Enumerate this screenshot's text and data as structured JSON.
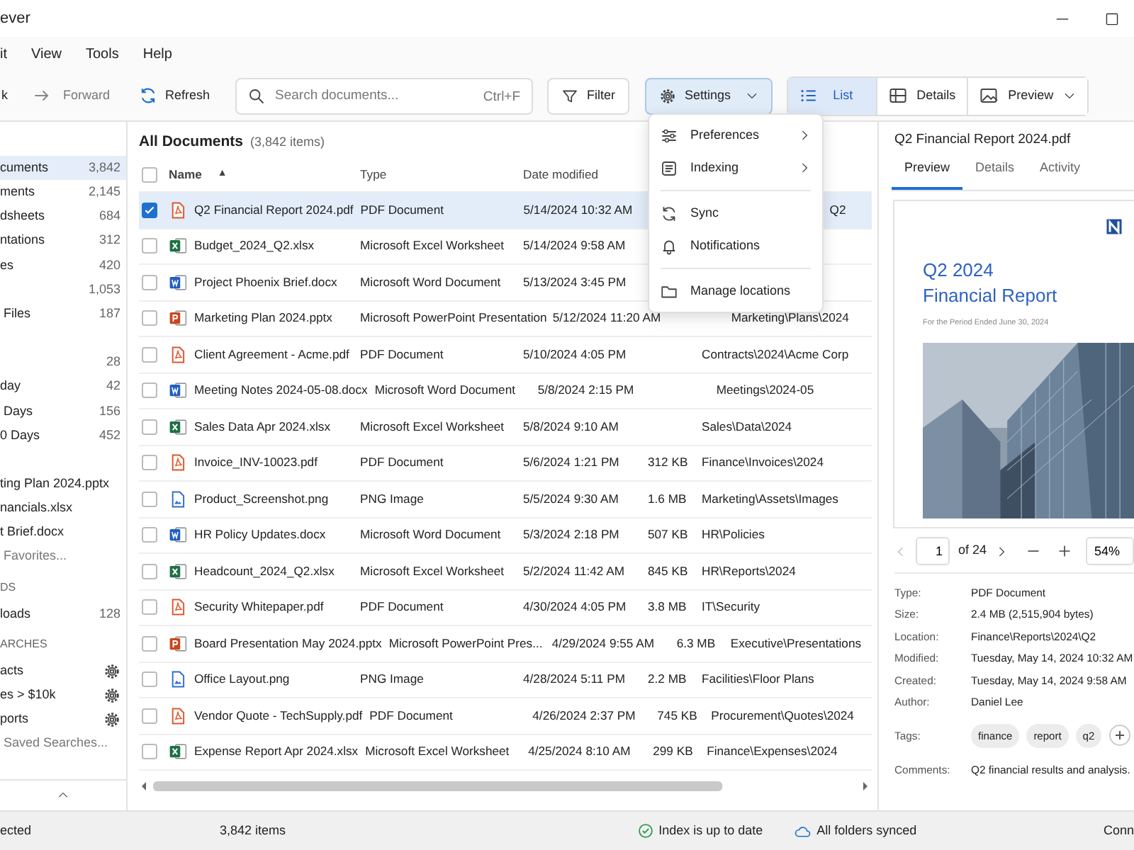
{
  "window": {
    "title": "ever"
  },
  "menu_bar": [
    "it",
    "View",
    "Tools",
    "Help"
  ],
  "toolbar": {
    "back": "k",
    "forward": {
      "label": "Forward",
      "disabled": true
    },
    "refresh": "Refresh",
    "search": {
      "placeholder": "Search documents...",
      "shortcut": "Ctrl+F"
    },
    "filter": "Filter",
    "settings": {
      "label": "Settings",
      "expanded": true
    },
    "views": [
      {
        "label": "List",
        "kind": "list",
        "selected": true,
        "dropdown": false
      },
      {
        "label": "Details",
        "kind": "details",
        "selected": false,
        "dropdown": false
      },
      {
        "label": "Preview",
        "kind": "preview",
        "selected": false,
        "dropdown": true
      }
    ]
  },
  "settings_menu": [
    [
      {
        "label": "Preferences",
        "kind": "preferences",
        "submenu": true
      },
      {
        "label": "Indexing",
        "kind": "indexing",
        "submenu": true
      }
    ],
    [
      {
        "label": "Sync",
        "kind": "sync",
        "submenu": false
      },
      {
        "label": "Notifications",
        "kind": "notifications",
        "submenu": false
      }
    ],
    [
      {
        "label": "Manage locations",
        "kind": "folder",
        "submenu": false
      }
    ]
  ],
  "sidebar": {
    "groups": [
      {
        "items": [
          {
            "label": "cuments",
            "count": "3,842",
            "selected": true
          },
          {
            "label": "ments",
            "count": "2,145",
            "selected": false
          },
          {
            "label": "dsheets",
            "count": "684",
            "selected": false
          },
          {
            "label": "ntations",
            "count": "312",
            "selected": false
          },
          {
            "label": "es",
            "count": "420",
            "selected": false
          },
          {
            "count": "1,053",
            "selected": false
          },
          {
            "label": " Files",
            "count": "187",
            "selected": false
          }
        ]
      },
      {
        "items": [
          {
            "count": "28",
            "selected": false
          },
          {
            "label": "day",
            "count": "42",
            "selected": false
          },
          {
            "label": " Days",
            "count": "156",
            "selected": false
          },
          {
            "label": "0 Days",
            "count": "452",
            "selected": false
          }
        ]
      },
      {
        "items": [
          {
            "label": "ting Plan 2024.pptx",
            "selected": false
          },
          {
            "label": "nancials.xlsx",
            "selected": false
          },
          {
            "label": "t Brief.docx",
            "selected": false
          },
          {
            "label": " Favorites...",
            "kind": "link",
            "selected": false
          }
        ]
      },
      {
        "heading": "DS",
        "items": [
          {
            "label": "loads",
            "count": "128",
            "selected": false
          }
        ]
      },
      {
        "heading": "ARCHES",
        "items": [
          {
            "label": "acts",
            "kind": "search",
            "selected": false
          },
          {
            "label": "es > $10k",
            "kind": "search",
            "selected": false
          },
          {
            "label": "ports",
            "kind": "search",
            "selected": false
          },
          {
            "label": " Saved Searches...",
            "kind": "link",
            "selected": false
          }
        ]
      }
    ]
  },
  "content": {
    "title": "All Documents",
    "count": "(3,842 items)",
    "select_all": false,
    "columns": [
      {
        "label": "Name",
        "sort_indicator": "▲"
      },
      {
        "label": "Type"
      },
      {
        "label": "Date modified"
      }
    ],
    "rows": [
      {
        "kind": "pdf",
        "name": "Q2 Financial Report 2024.pdf",
        "type": "PDF Document",
        "modified": "5/14/2024 10:32 AM",
        "location": "Q2",
        "checked": true,
        "selected": true
      },
      {
        "kind": "xlsx",
        "name": "Budget_2024_Q2.xlsx",
        "type": "Microsoft Excel Worksheet",
        "modified": "5/14/2024 9:58 AM",
        "checked": false,
        "selected": false
      },
      {
        "kind": "docx",
        "name": "Project Phoenix Brief.docx",
        "type": "Microsoft Word Document",
        "modified": "5/13/2024 3:45 PM",
        "checked": false,
        "selected": false
      },
      {
        "kind": "pptx",
        "name": "Marketing Plan 2024.pptx",
        "type": "Microsoft PowerPoint Presentation",
        "modified": "5/12/2024 11:20 AM",
        "location": "Marketing\\Plans\\2024",
        "checked": false,
        "selected": false
      },
      {
        "kind": "pdf",
        "name": "Client Agreement - Acme.pdf",
        "type": "PDF Document",
        "modified": "5/10/2024 4:05 PM",
        "location": "Contracts\\2024\\Acme Corp",
        "checked": false,
        "selected": false
      },
      {
        "kind": "docx",
        "name": "Meeting Notes 2024-05-08.docx",
        "type": "Microsoft Word Document",
        "modified": "5/8/2024 2:15 PM",
        "location": "Meetings\\2024-05",
        "checked": false,
        "selected": false
      },
      {
        "kind": "xlsx",
        "name": "Sales Data Apr 2024.xlsx",
        "type": "Microsoft Excel Worksheet",
        "modified": "5/8/2024 9:10 AM",
        "location": "Sales\\Data\\2024",
        "checked": false,
        "selected": false
      },
      {
        "kind": "pdf",
        "name": "Invoice_INV-10023.pdf",
        "type": "PDF Document",
        "modified": "5/6/2024 1:21 PM",
        "size": "312 KB",
        "location": "Finance\\Invoices\\2024",
        "checked": false,
        "selected": false
      },
      {
        "kind": "png",
        "name": "Product_Screenshot.png",
        "type": "PNG Image",
        "modified": "5/5/2024 9:30 AM",
        "size": "1.6 MB",
        "location": "Marketing\\Assets\\Images",
        "checked": false,
        "selected": false
      },
      {
        "kind": "docx",
        "name": "HR Policy Updates.docx",
        "type": "Microsoft Word Document",
        "modified": "5/3/2024 2:18 PM",
        "size": "507 KB",
        "location": "HR\\Policies",
        "checked": false,
        "selected": false
      },
      {
        "kind": "xlsx",
        "name": "Headcount_2024_Q2.xlsx",
        "type": "Microsoft Excel Worksheet",
        "modified": "5/2/2024 11:42 AM",
        "size": "845 KB",
        "location": "HR\\Reports\\2024",
        "checked": false,
        "selected": false
      },
      {
        "kind": "pdf",
        "name": "Security Whitepaper.pdf",
        "type": "PDF Document",
        "modified": "4/30/2024 4:05 PM",
        "size": "3.8 MB",
        "location": "IT\\Security",
        "checked": false,
        "selected": false
      },
      {
        "kind": "pptx",
        "name": "Board Presentation May 2024.pptx",
        "type": "Microsoft PowerPoint Pres...",
        "modified": "4/29/2024 9:55 AM",
        "size": "6.3 MB",
        "location": "Executive\\Presentations",
        "checked": false,
        "selected": false
      },
      {
        "kind": "png",
        "name": "Office Layout.png",
        "type": "PNG Image",
        "modified": "4/28/2024 5:11 PM",
        "size": "2.2 MB",
        "location": "Facilities\\Floor Plans",
        "checked": false,
        "selected": false
      },
      {
        "kind": "pdf",
        "name": "Vendor Quote - TechSupply.pdf",
        "type": "PDF Document",
        "modified": "4/26/2024 2:37 PM",
        "size": "745 KB",
        "location": "Procurement\\Quotes\\2024",
        "checked": false,
        "selected": false
      },
      {
        "kind": "xlsx",
        "name": "Expense Report Apr 2024.xlsx",
        "type": "Microsoft Excel Worksheet",
        "modified": "4/25/2024 8:10 AM",
        "size": "299 KB",
        "location": "Finance\\Expenses\\2024",
        "checked": false,
        "selected": false
      }
    ]
  },
  "preview": {
    "title": "Q2 Financial Report 2024.pdf",
    "tabs": [
      {
        "label": "Preview",
        "selected": true
      },
      {
        "label": "Details",
        "selected": false
      },
      {
        "label": "Activity",
        "selected": false
      }
    ],
    "document": {
      "heading": [
        "Q2 2024",
        "Financial Report"
      ],
      "subtitle": "For the Period Ended June 30, 2024",
      "kind": "picture"
    },
    "pager": {
      "page": "1",
      "total": "of 24",
      "zoom": "54%",
      "previous_disabled": true
    },
    "properties": [
      {
        "label": "Type:",
        "value": "PDF Document"
      },
      {
        "label": "Size:",
        "value": "2.4 MB (2,515,904 bytes)"
      },
      {
        "label": "Location:",
        "value": "Finance\\Reports\\2024\\Q2"
      },
      {
        "label": "Modified:",
        "value": "Tuesday, May 14, 2024 10:32 AM"
      },
      {
        "label": "Created:",
        "value": "Tuesday, May 14, 2024 9:58 AM"
      },
      {
        "label": "Author:",
        "value": "Daniel Lee"
      }
    ],
    "tags": {
      "label": "Tags:",
      "items": [
        "finance",
        "report",
        "q2"
      ]
    },
    "comments": {
      "label": "Comments:",
      "value": "Q2 financial results and analysis."
    }
  },
  "status_bar": {
    "selection": "ected",
    "items": "3,842 items",
    "index": "Index is up to date",
    "sync": "All folders synced",
    "connection": "Conn"
  }
}
